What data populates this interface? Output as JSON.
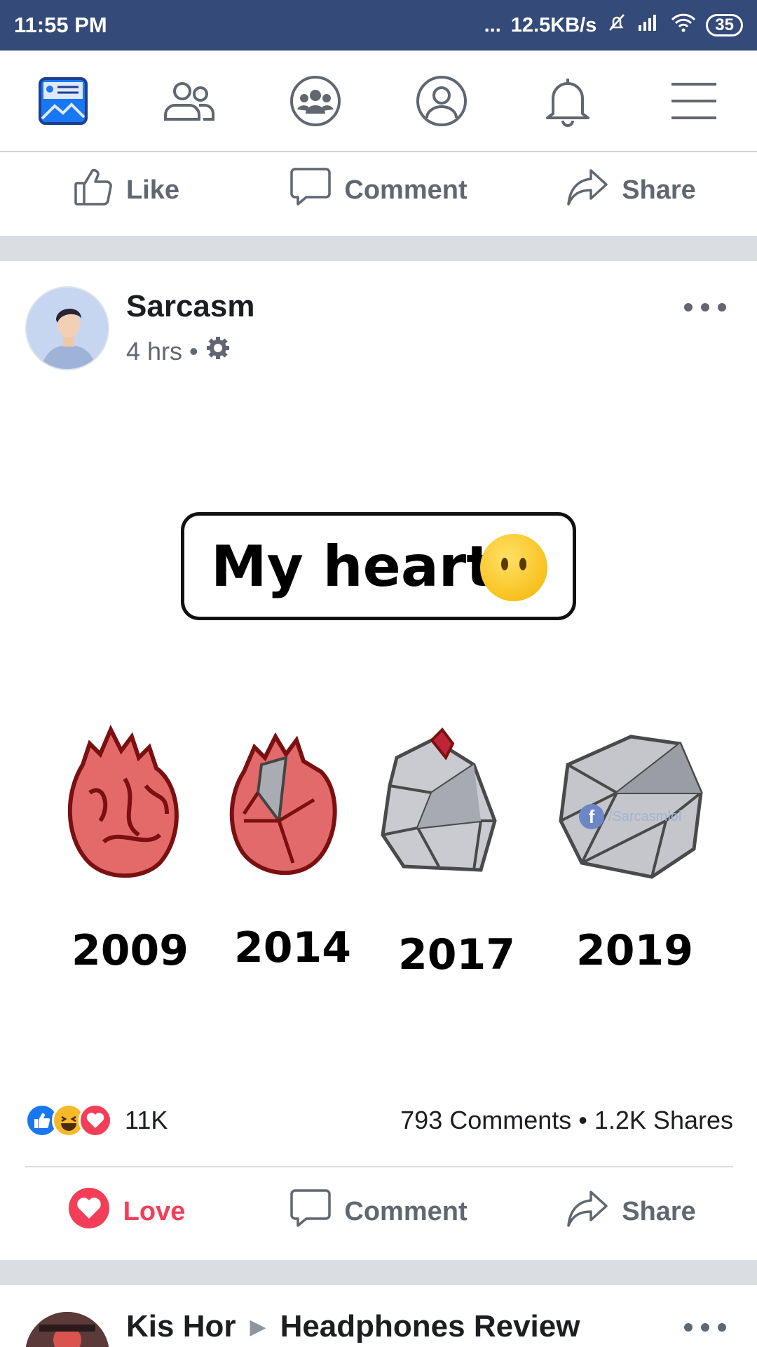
{
  "status_bar": {
    "time": "11:55 PM",
    "dots": "...",
    "network_speed": "12.5KB/s",
    "battery": "35"
  },
  "top_nav": {
    "items": [
      "news-feed-icon",
      "friends-icon",
      "groups-icon",
      "profile-icon",
      "notifications-icon",
      "menu-icon"
    ],
    "active_color": "#1877f2"
  },
  "prev_post_actions": {
    "like": "Like",
    "comment": "Comment",
    "share": "Share"
  },
  "post": {
    "author": "Sarcasm",
    "time": "4 hrs",
    "separator": "•",
    "image": {
      "title": "My heart",
      "years": [
        "2009",
        "2014",
        "2017",
        "2019"
      ],
      "watermark": "/Sarcasmlol"
    },
    "reactions_count": "11K",
    "stats": "793 Comments • 1.2K Shares",
    "actions": {
      "love": "Love",
      "comment": "Comment",
      "share": "Share"
    }
  },
  "next_post": {
    "author": "Kis Hor",
    "group": "Headphones Review"
  },
  "colors": {
    "status_bar": "#344a79",
    "love": "#f33e58",
    "like_blue": "#1877f2",
    "divider": "#dadde1"
  }
}
